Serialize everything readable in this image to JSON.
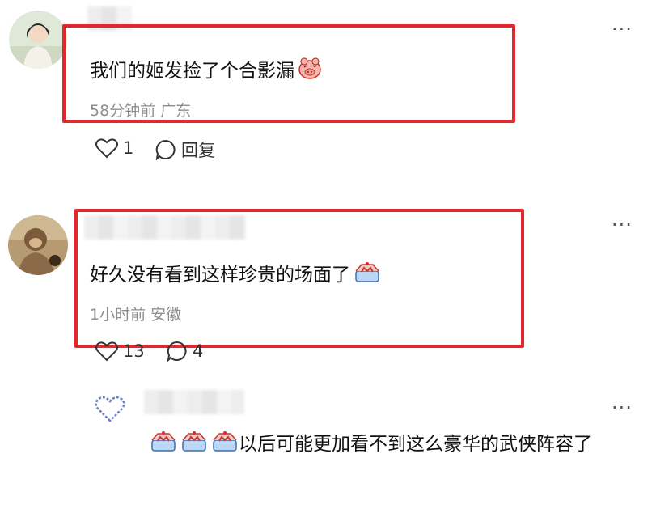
{
  "comments": [
    {
      "text": "我们的姬发捡了个合影漏",
      "emoji": "pig-face-emoji",
      "time": "58分钟前",
      "location": "广东",
      "likes": "1",
      "reply_label": "回复"
    },
    {
      "text": "好久没有看到这样珍贵的场面了",
      "emoji": "cake-emoji",
      "time": "1小时前",
      "location": "安徽",
      "likes": "13",
      "reply_count": "4"
    }
  ],
  "reply": {
    "text": "以后可能更加看不到这么豪华的武侠阵容了",
    "emojis": [
      "cake-emoji",
      "cake-emoji",
      "cake-emoji"
    ]
  },
  "more_label": "···",
  "colors": {
    "highlight": "#e4262d",
    "meta": "#8e8e8e"
  }
}
